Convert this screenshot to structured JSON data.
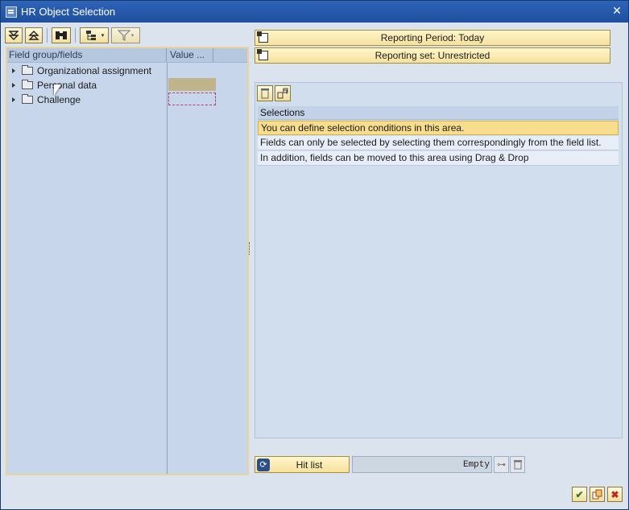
{
  "window": {
    "title": "HR Object Selection"
  },
  "tree": {
    "col_headers": [
      "Field group/fields",
      "Value ..."
    ],
    "items": [
      "Organizational assignment",
      "Personal data",
      "Challenge"
    ]
  },
  "buttons": {
    "reporting_period": "Reporting Period: Today",
    "reporting_set": "Reporting set: Unrestricted",
    "hit_list": "Hit list"
  },
  "selections": {
    "header": "Selections",
    "rows": [
      "You can define selection conditions in this area.",
      "Fields can only be selected by selecting them correspondingly from the field list.",
      "In addition, fields can be moved to this area using Drag & Drop"
    ]
  },
  "hit_status": "Empty",
  "icons": {
    "toolbar": [
      "expand-all-icon",
      "collapse-all-icon",
      "find-icon",
      "structure-icon",
      "filter-icon"
    ],
    "right_toolbar": [
      "delete-icon",
      "transfer-icon"
    ],
    "bottom": [
      "check-icon",
      "copy-icon",
      "cancel-icon"
    ]
  },
  "colors": {
    "titlebar": "#1f4f9e",
    "button_gold": "#f5e19f",
    "highlight_row": "#f7dd8d"
  }
}
